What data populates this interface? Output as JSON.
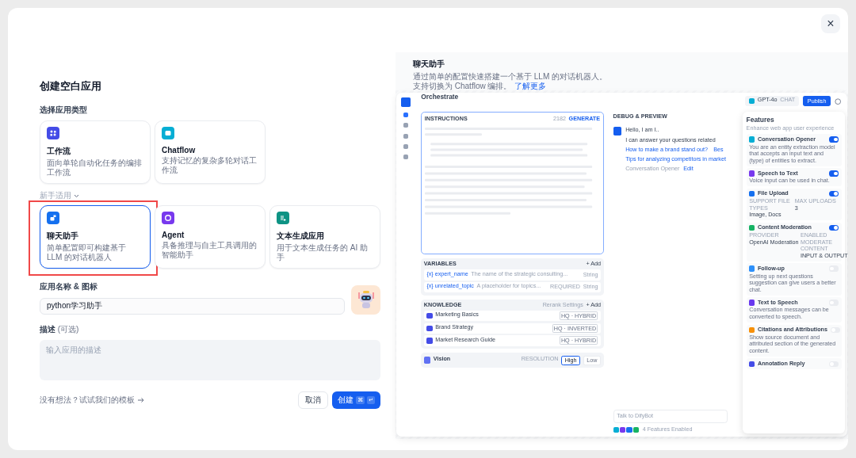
{
  "dialog": {
    "title": "创建空白应用",
    "close": "×"
  },
  "app_type": {
    "label": "选择应用类型",
    "types": [
      {
        "name": "工作流",
        "desc": "面向单轮自动化任务的编排工作流",
        "color": "#444ce7",
        "selected": false,
        "highlighted": false
      },
      {
        "name": "Chatflow",
        "desc": "支持记忆的复杂多轮对话工作流",
        "color": "#06aed4",
        "selected": false,
        "highlighted": false
      }
    ],
    "beginner_label": "新手适用",
    "beginner_types": [
      {
        "name": "聊天助手",
        "desc": "简单配置即可构建基于 LLM 的对话机器人",
        "color": "#1570ef",
        "selected": true,
        "highlighted": true
      },
      {
        "name": "Agent",
        "desc": "具备推理与自主工具调用的智能助手",
        "color": "#7839ee",
        "selected": false,
        "highlighted": false
      },
      {
        "name": "文本生成应用",
        "desc": "用于文本生成任务的 AI 助手",
        "color": "#0e9384",
        "selected": false,
        "highlighted": false
      }
    ]
  },
  "name_field": {
    "label": "应用名称 & 图标",
    "value": "python学习助手"
  },
  "desc_field": {
    "label": "描述",
    "optional": "(可选)",
    "placeholder": "输入应用的描述"
  },
  "footer": {
    "template_link": "没有想法？试试我们的模板",
    "cancel": "取消",
    "create": "创建",
    "keys": [
      "⌘",
      "↵"
    ]
  },
  "info": {
    "title": "聊天助手",
    "desc": "通过简单的配置快速搭建一个基于 LLM 的对话机器人。支持切换为 Chatflow 编排。",
    "link": "了解更多"
  },
  "preview": {
    "title": "Orchestrate",
    "model": "GPT-4o",
    "mode": "CHAT",
    "publish": "Publish",
    "instructions": {
      "label": "INSTRUCTIONS",
      "count": "2182",
      "generate": "GENERATE"
    },
    "variables": {
      "label": "VARIABLES",
      "add": "+ Add",
      "rows": [
        {
          "name": "{x} expert_name",
          "desc": "The name of the strategic consulting...",
          "badge": null,
          "type": "String"
        },
        {
          "name": "{x} unrelated_topic",
          "desc": "A placeholder for topics...",
          "badge": "REQUIRED",
          "type": "String"
        }
      ]
    },
    "knowledge": {
      "label": "KNOWLEDGE",
      "rerank": "Rerank Settings",
      "add": "+ Add",
      "items": [
        {
          "name": "Marketing Basics",
          "tag": "HQ · HYBRID"
        },
        {
          "name": "Brand Strategy",
          "tag": "HQ · INVERTED"
        },
        {
          "name": "Market Research Guide",
          "tag": "HQ · HYBRID"
        }
      ]
    },
    "vision": {
      "label": "Vision",
      "resolution": "RESOLUTION",
      "options": [
        {
          "label": "High",
          "selected": true
        },
        {
          "label": "Low",
          "selected": false
        }
      ]
    },
    "debug": {
      "title": "DEBUG & PREVIEW",
      "greeting": "Hello, I am I..",
      "intro": "I can answer your questions related",
      "suggestions": [
        "How to make a brand stand out?",
        "Bes",
        "Tips for analyzing competitors in market"
      ],
      "opener": "Conversation Opener",
      "edit": "Edit",
      "input_placeholder": "Talk to DifyBot",
      "enabled": "4 Features Enabled"
    },
    "features": {
      "title": "Features",
      "subtitle": "Enhance web app user experience",
      "items": [
        {
          "name": "Conversation Opener",
          "desc": "You are an entity extraction model that accepts an input text and (type) of entities to extract.",
          "on": true,
          "color": "#06aed4"
        },
        {
          "name": "Speech to Text",
          "desc": "Voice input can be used in chat.",
          "on": true,
          "color": "#7839ee"
        },
        {
          "name": "File Upload",
          "fields": [
            {
              "label": "SUPPORT FILE TYPES",
              "value": "Image, Docs"
            },
            {
              "label": "MAX UPLOADS",
              "value": "3"
            }
          ],
          "on": true,
          "color": "#1570ef"
        },
        {
          "name": "Content Moderation",
          "fields": [
            {
              "label": "PROVIDER",
              "value": "OpenAI Moderation"
            },
            {
              "label": "ENABLED MODERATE CONTENT",
              "value": "INPUT & OUTPUT"
            }
          ],
          "on": true,
          "color": "#16b364"
        },
        {
          "name": "Follow-up",
          "desc": "Setting up next questions suggestion can give users a better chat.",
          "on": false,
          "color": "#2e90fa"
        },
        {
          "name": "Text to Speech",
          "desc": "Conversation messages can be converted to speech.",
          "on": false,
          "color": "#6938ef"
        },
        {
          "name": "Citations and Attributions",
          "desc": "Show source document and attributed section of the generated content.",
          "on": false,
          "color": "#f79009"
        },
        {
          "name": "Annotation Reply",
          "on": false,
          "color": "#444ce7"
        }
      ]
    }
  }
}
